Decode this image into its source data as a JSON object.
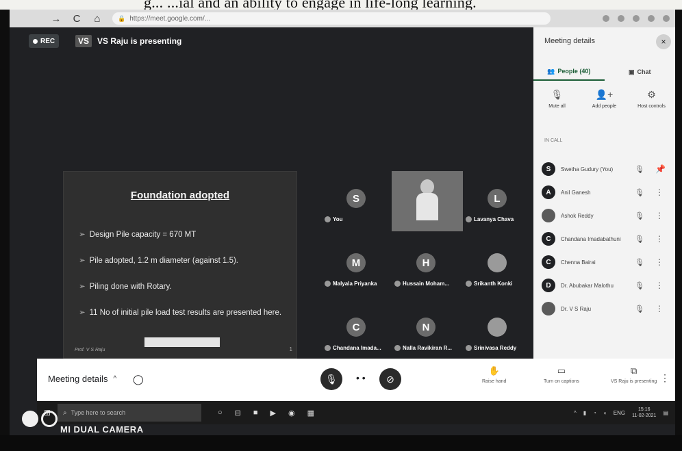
{
  "document": {
    "text_behind": "g... ...ial and an ability to engage in life-long learning."
  },
  "browser": {
    "back_icon": "arrow-left-icon",
    "forward_glyph": "→",
    "reload_glyph": "C",
    "home_glyph": "⌂",
    "url": "https://meet.google.com/..."
  },
  "meet": {
    "rec_label": "REC",
    "presenter_initials": "VS",
    "presenter_text": "VS Raju is presenting"
  },
  "slide": {
    "title": "Foundation adopted",
    "bullets": [
      "Design Pile capacity = 670 MT",
      "Pile adopted, 1.2 m diameter (against 1.5).",
      "Piling done with Rotary.",
      "11 No of initial pile load test results are presented here."
    ],
    "footer": "Prof. V S Raju",
    "page_num": "1"
  },
  "grid": {
    "tiles": [
      {
        "initial": "S",
        "name": "You"
      },
      {
        "initial": "L",
        "name": "Lavanya Chava"
      },
      {
        "initial": "M",
        "name": "Malyala Priyanka"
      },
      {
        "initial": "H",
        "name": "Hussain Moham..."
      },
      {
        "initial": "",
        "name": "Srikanth Konki"
      },
      {
        "initial": "C",
        "name": "Chandana Imada..."
      },
      {
        "initial": "N",
        "name": "Nalla Ravikiran R..."
      },
      {
        "initial": "",
        "name": "Srinivasa Reddy"
      }
    ]
  },
  "panel": {
    "title": "Meeting details",
    "close": "×",
    "tab_people": "People (40)",
    "tab_chat": "Chat",
    "actions": {
      "mute_all": "Mute all",
      "add_people": "Add people",
      "host_controls": "Host controls"
    },
    "section": "IN CALL",
    "people": [
      {
        "initial": "S",
        "name": "Swetha Gudury (You)"
      },
      {
        "initial": "A",
        "name": "Anil Ganesh"
      },
      {
        "initial": "",
        "name": "Ashok Reddy"
      },
      {
        "initial": "C",
        "name": "Chandana Imadabathuni"
      },
      {
        "initial": "C",
        "name": "Chenna Bairai"
      },
      {
        "initial": "D",
        "name": "Dr. Abubakar Malothu"
      },
      {
        "initial": "",
        "name": "Dr. V S Raju"
      }
    ]
  },
  "controls": {
    "meeting_details": "Meeting details",
    "caret": "^",
    "more_dots": "• •",
    "raise_hand": "Raise hand",
    "captions": "Turn on captions",
    "present": "VS Raju is presenting",
    "more": "⋮"
  },
  "taskbar": {
    "search_placeholder": "Type here to search",
    "clock_time": "15:16",
    "clock_date": "11-02-2021",
    "lang": "ENG"
  },
  "watermark": {
    "text": "MI DUAL CAMERA"
  }
}
